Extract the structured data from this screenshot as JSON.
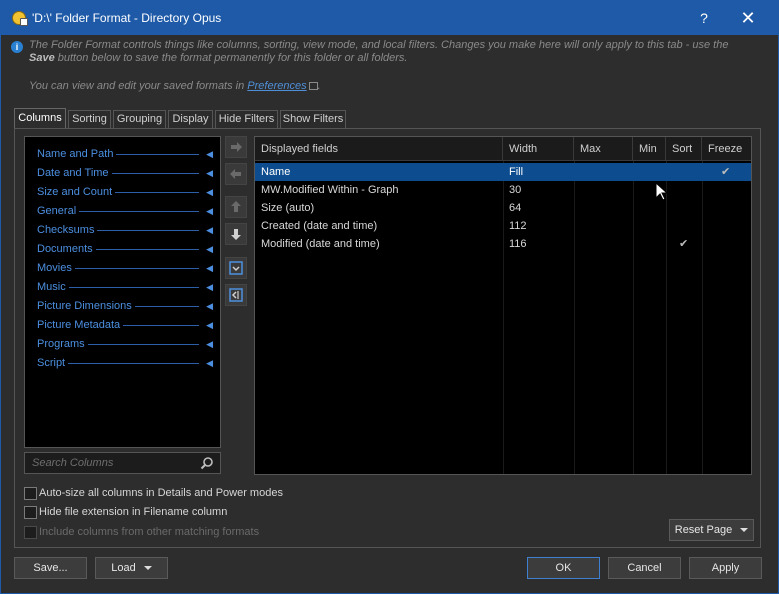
{
  "window": {
    "title": "'D:\\' Folder Format - Directory Opus",
    "help_label": "?",
    "close_label": "✕"
  },
  "info": {
    "text_part1": "The Folder Format controls things like columns, sorting, view mode, and local filters. Changes you make here will only apply to this tab - use the ",
    "text_bold": "Save",
    "text_part2": " button below to save the format permanently for this folder or all folders.",
    "line2_prefix": "You can view and edit your saved formats in ",
    "line2_link": "Preferences",
    "line2_suffix": "."
  },
  "tabs": [
    {
      "label": "Columns",
      "active": true
    },
    {
      "label": "Sorting",
      "active": false
    },
    {
      "label": "Grouping",
      "active": false
    },
    {
      "label": "Display",
      "active": false
    },
    {
      "label": "Hide Filters",
      "active": false
    },
    {
      "label": "Show Filters",
      "active": false
    }
  ],
  "categories": [
    "Name and Path",
    "Date and Time",
    "Size and Count",
    "General",
    "Checksums",
    "Documents",
    "Movies",
    "Music",
    "Picture Dimensions",
    "Picture Metadata",
    "Programs",
    "Script"
  ],
  "search": {
    "placeholder": "Search Columns"
  },
  "table": {
    "headers": [
      "Displayed fields",
      "Width",
      "Max",
      "Min",
      "Sort",
      "Freeze"
    ],
    "rows": [
      {
        "field": "Name",
        "width": "Fill",
        "max": "",
        "min": "",
        "sort": false,
        "freeze": true,
        "selected": true
      },
      {
        "field": "MW.Modified Within - Graph",
        "width": "30",
        "max": "",
        "min": "",
        "sort": false,
        "freeze": false,
        "selected": false
      },
      {
        "field": "Size (auto)",
        "width": "64",
        "max": "",
        "min": "",
        "sort": false,
        "freeze": false,
        "selected": false
      },
      {
        "field": "Created (date and time)",
        "width": "112",
        "max": "",
        "min": "",
        "sort": false,
        "freeze": false,
        "selected": false
      },
      {
        "field": "Modified (date and time)",
        "width": "116",
        "max": "",
        "min": "",
        "sort": true,
        "freeze": false,
        "selected": false
      }
    ]
  },
  "options": {
    "autosize_label": "Auto-size all columns in Details and Power modes",
    "autosize_checked": false,
    "hide_ext_label": "Hide file extension in Filename column",
    "hide_ext_checked": false,
    "include_label": "Include columns from other matching formats",
    "include_checked": false
  },
  "buttons": {
    "reset_page": "Reset Page",
    "save": "Save...",
    "load": "Load",
    "ok": "OK",
    "cancel": "Cancel",
    "apply": "Apply"
  },
  "colors": {
    "titlebar": "#1e5aa8",
    "accent_blue": "#4c8fe0",
    "selection": "#0d4d8f"
  }
}
